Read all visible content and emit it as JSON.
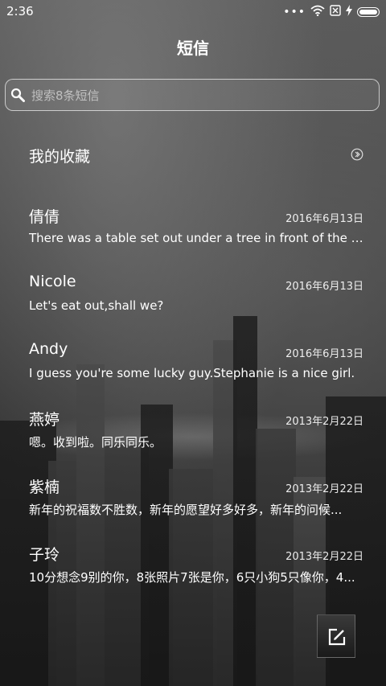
{
  "status_bar": {
    "time": "2:36",
    "dots": "•••",
    "icons": [
      "wifi-icon",
      "no-sim-icon",
      "charging-icon",
      "battery-icon"
    ]
  },
  "header": {
    "title": "短信"
  },
  "search": {
    "placeholder": "搜索8条短信"
  },
  "favorites": {
    "label": "我的收藏"
  },
  "conversations": [
    {
      "name": "倩倩",
      "date": "2016年6月13日",
      "preview": "There was a table set out under a tree in front of the ho..."
    },
    {
      "name": "Nicole",
      "date": "2016年6月13日",
      "preview": "Let's eat out,shall we?"
    },
    {
      "name": "Andy",
      "date": "2016年6月13日",
      "preview": "I guess you're some lucky guy.Stephanie is a nice girl."
    },
    {
      "name": "燕婷",
      "date": "2013年2月22日",
      "preview": "嗯。收到啦。同乐同乐。"
    },
    {
      "name": "紫楠",
      "date": "2013年2月22日",
      "preview": "新年的祝福数不胜数，新年的愿望好多好多，新年的问候..."
    },
    {
      "name": "子玲",
      "date": "2013年2月22日",
      "preview": "10分想念9别的你，8张照片7张是你，6只小狗5只像你，4..."
    }
  ],
  "compose": {
    "icon": "compose-icon"
  }
}
